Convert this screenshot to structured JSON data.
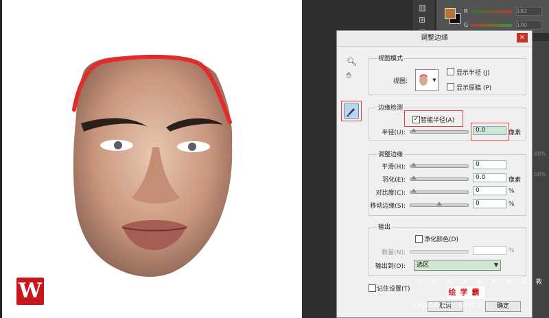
{
  "dialog": {
    "title": "调整边缘",
    "close_icon": "×"
  },
  "view_mode": {
    "title": "视图模式",
    "view_label": "视图:",
    "show_radius": "显示半径 (J)",
    "show_original": "显示原稿 (P)"
  },
  "edge_detection": {
    "title": "边缘检测",
    "smart_radius": "智能半径(A)",
    "smart_radius_checked": "✓",
    "radius_label": "半径(U):",
    "radius_value": "0.0",
    "radius_unit": "像素"
  },
  "adjust_edge": {
    "title": "调整边缘",
    "rows": [
      {
        "label": "平滑(H):",
        "value": "0",
        "unit": ""
      },
      {
        "label": "羽化(E):",
        "value": "0.0",
        "unit": "像素"
      },
      {
        "label": "对比度(C):",
        "value": "0",
        "unit": "%"
      },
      {
        "label": "移动边缘(S):",
        "value": "0",
        "unit": "%"
      }
    ]
  },
  "output": {
    "title": "输出",
    "decontaminate": "净化颜色(D)",
    "amount_label": "数量(N):",
    "amount_unit": "%",
    "output_to_label": "输出到(O):",
    "output_to_value": "选区"
  },
  "remember_settings": "记住设置(T)",
  "buttons": {
    "cancel": "取消",
    "ok": "确定"
  },
  "color_panel": {
    "r_label": "R",
    "g_label": "G",
    "r_value": "182",
    "g_value": "100",
    "fg_color": "#b57531",
    "bg_color": "#111111"
  },
  "right_panel": {
    "pct1": "00%",
    "pct2": "00%"
  },
  "watermark": {
    "line1": "汉 语 资 源 免 费 精 品 教 程",
    "brand": "绘学霸",
    "line2": "E·App5的课本、视网集合"
  },
  "logo": {
    "letter": "W"
  }
}
